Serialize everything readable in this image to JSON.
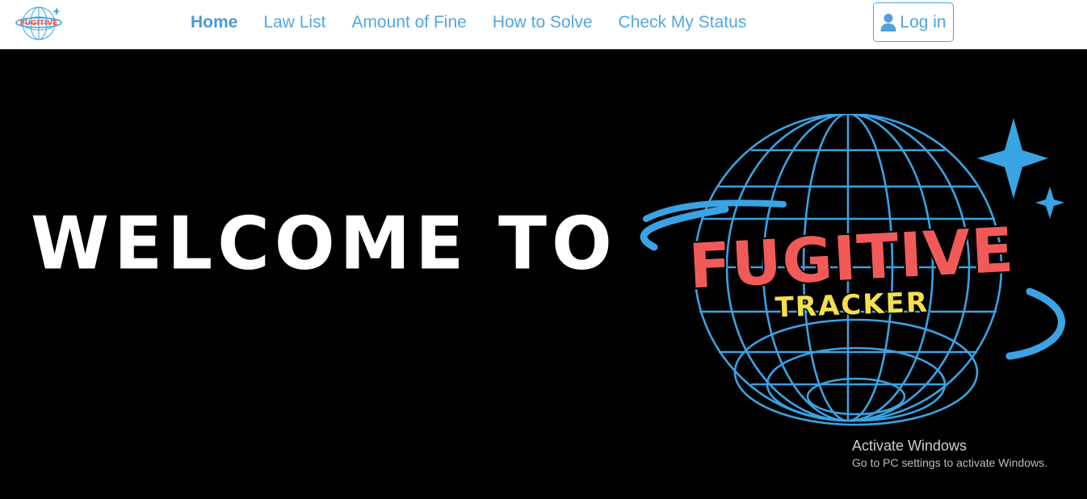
{
  "nav": {
    "logo": {
      "wordmark": "FUGITIVE"
    },
    "links": [
      {
        "label": "Home",
        "active": true
      },
      {
        "label": "Law List",
        "active": false
      },
      {
        "label": "Amount of Fine",
        "active": false
      },
      {
        "label": "How to Solve",
        "active": false
      },
      {
        "label": "Check My Status",
        "active": false
      }
    ],
    "login": {
      "label": "Log in",
      "icon": "user-icon"
    }
  },
  "hero": {
    "welcome": "WELCOME TO",
    "logo": {
      "top": "FUGITIVE",
      "bottom": "TRACKER"
    }
  },
  "watermark": {
    "title": "Activate Windows",
    "subtitle": "Go to PC settings to activate Windows."
  },
  "colors": {
    "accent": "#55a6e0",
    "globe": "#3aa3e3",
    "logo_red": "#f25a5a",
    "logo_yellow": "#f4e04d",
    "background": "#000000"
  }
}
